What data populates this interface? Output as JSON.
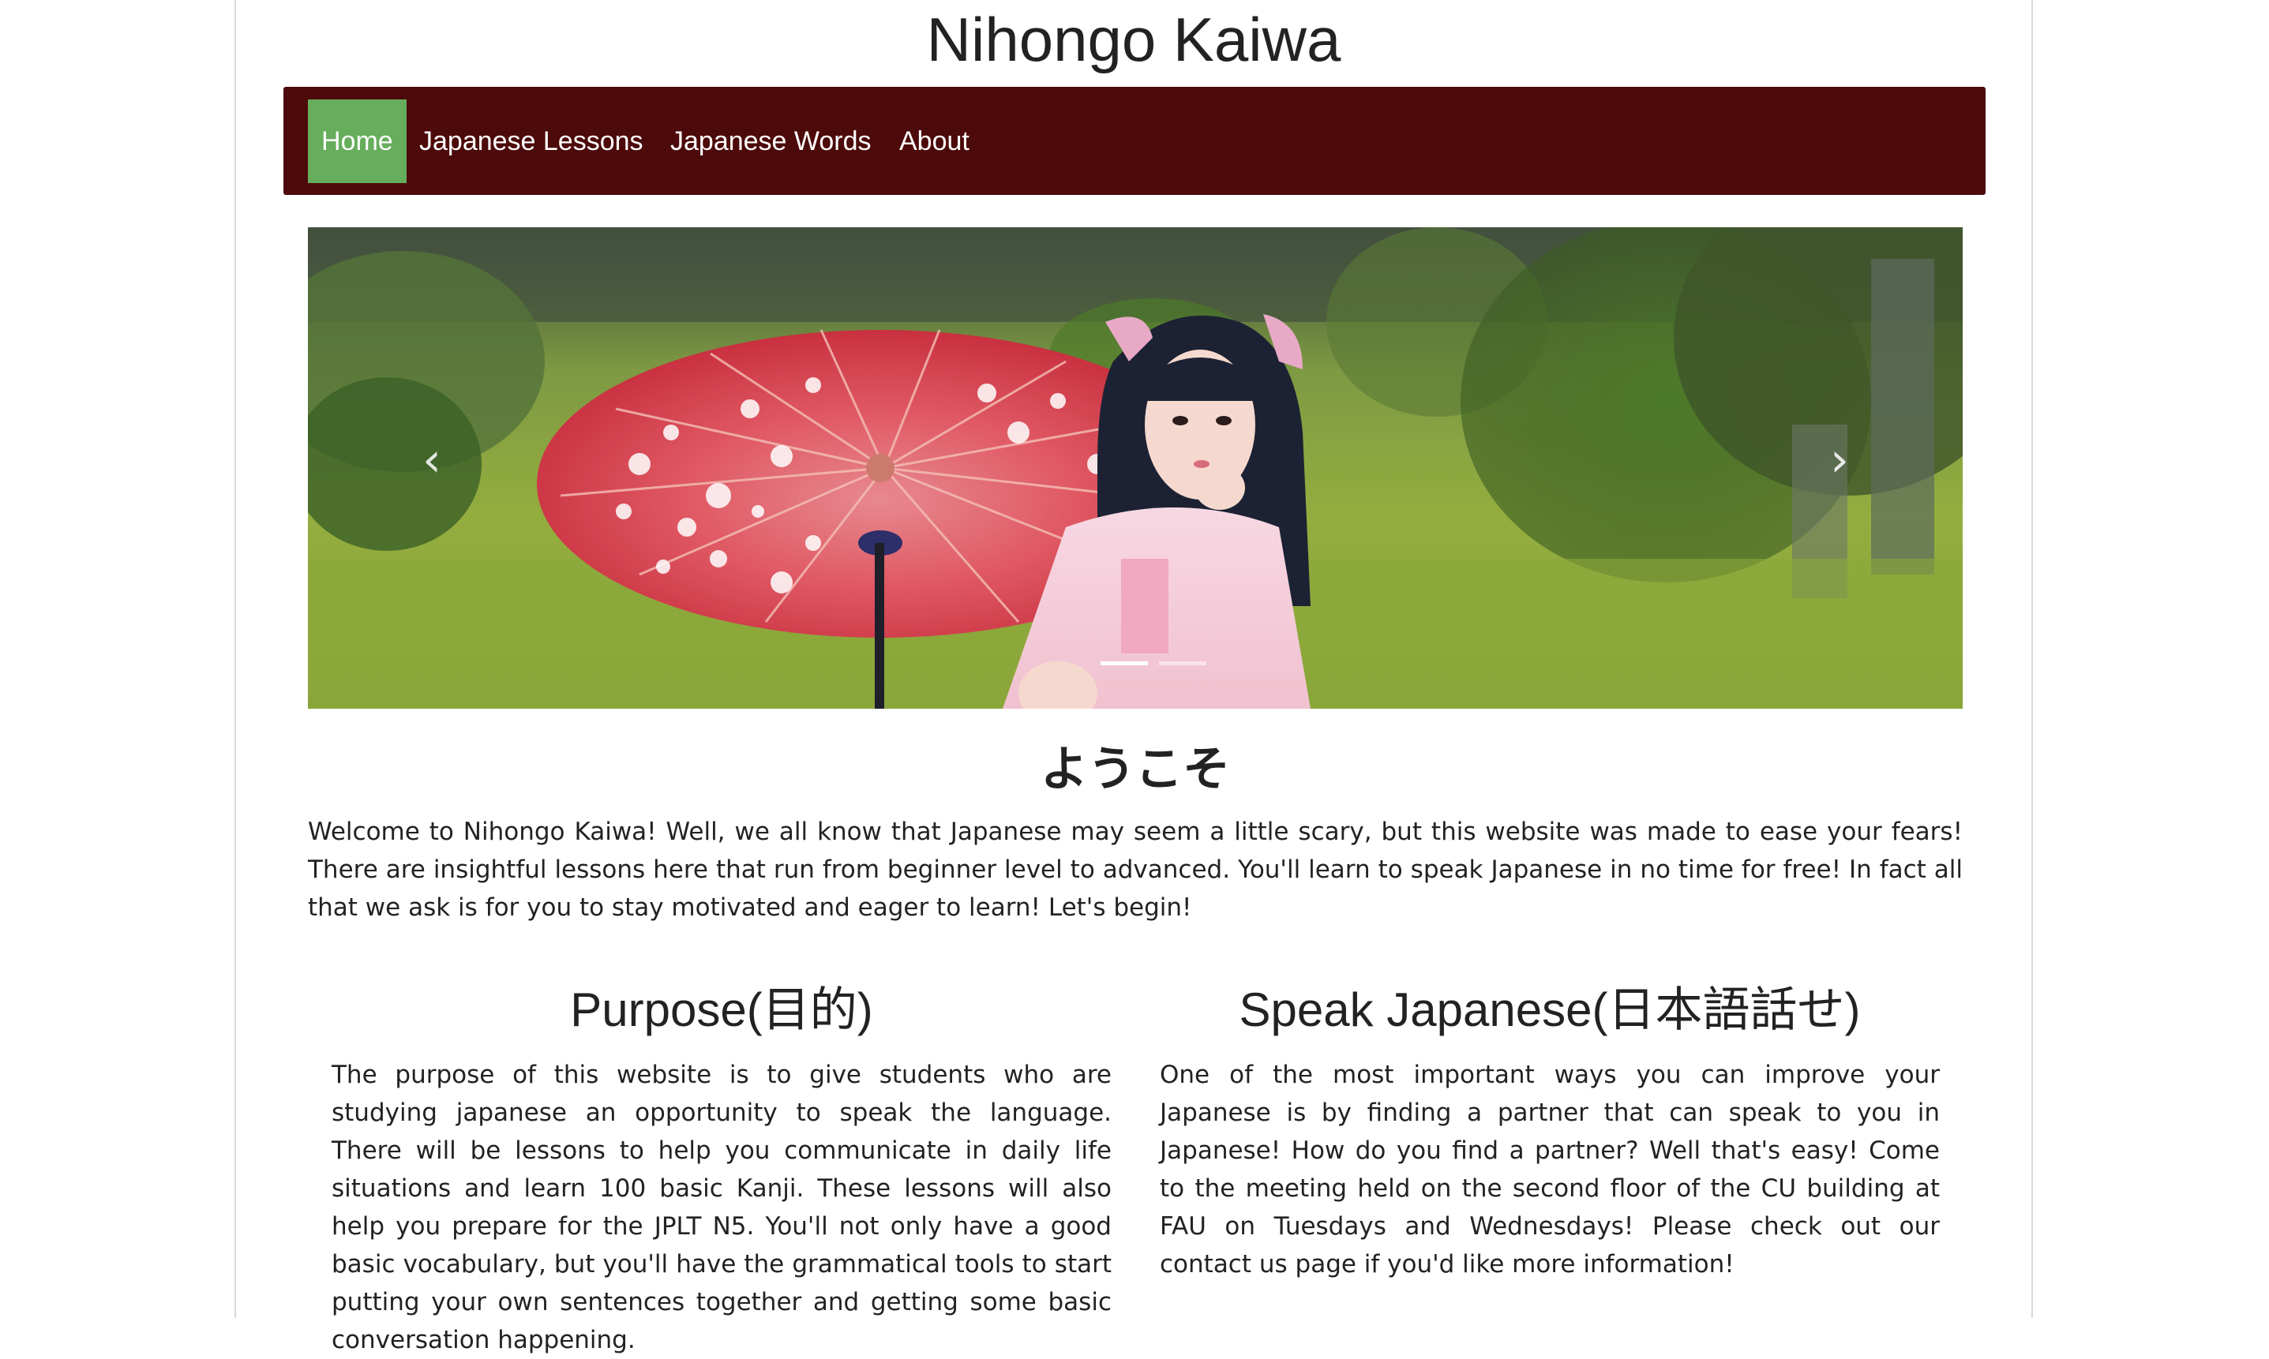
{
  "site": {
    "title": "Nihongo Kaiwa"
  },
  "nav": {
    "items": [
      {
        "label": "Home",
        "active": true
      },
      {
        "label": "Japanese Lessons"
      },
      {
        "label": "Japanese Words"
      },
      {
        "label": "About"
      }
    ]
  },
  "carousel": {
    "prev_icon": "chevron-left-icon",
    "next_icon": "chevron-right-icon",
    "prev_glyph": "‹",
    "next_glyph": "›",
    "slide_count": 2,
    "active_slide": 1
  },
  "welcome": {
    "heading": "ようこそ",
    "text": "Welcome to Nihongo Kaiwa! Well, we all know that Japanese may seem a little scary, but this website was made to ease your fears! There are insightful lessons here that run from beginner level to advanced. You'll learn to speak Japanese in no time for free! In fact all that we ask is for you to stay motivated and eager to learn! Let's begin!"
  },
  "columns": [
    {
      "heading": "Purpose(目的)",
      "text": "The purpose of this website is to give students who are studying japanese an opportunity to speak the language. There will be lessons to help you communicate in daily life situations and learn 100 basic Kanji. These lessons will also help you prepare for the JPLT N5. You'll not only have a good basic vocabulary, but you'll have the grammatical tools to start putting your own sentences together and getting some basic conversation happening."
    },
    {
      "heading": "Speak Japanese(日本語話せ)",
      "text": "One of the most important ways you can improve your Japanese is by finding a partner that can speak to you in Japanese! How do you find a partner? Well that's easy! Come to the meeting held on the second floor of the CU building at FAU on Tuesdays and Wednesdays! Please check out our contact us page if you'd like more information!"
    }
  ],
  "colors": {
    "navbar": "#4d0a0a",
    "active_nav": "#66ad5c",
    "text": "#222222"
  }
}
